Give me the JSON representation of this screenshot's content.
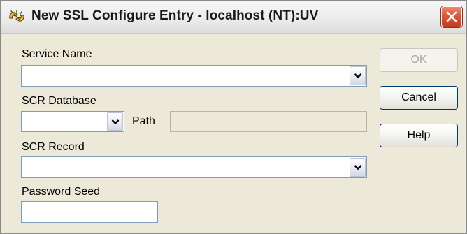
{
  "window": {
    "title": "New SSL Configure Entry - localhost (NT):UV",
    "title_icon": "app-hands-icon",
    "close_icon": "close-icon"
  },
  "form": {
    "service_name": {
      "label": "Service Name",
      "value": ""
    },
    "scr_database": {
      "label": "SCR Database",
      "value": ""
    },
    "path": {
      "label": "Path",
      "value": ""
    },
    "scr_record": {
      "label": "SCR Record",
      "value": ""
    },
    "password_seed": {
      "label": "Password Seed",
      "value": ""
    }
  },
  "buttons": {
    "ok": "OK",
    "cancel": "Cancel",
    "help": "Help"
  },
  "colors": {
    "dialog_background": "#ece9d8",
    "input_border": "#7f9db9",
    "button_border": "#003c74",
    "close_button": "#e0553a"
  }
}
